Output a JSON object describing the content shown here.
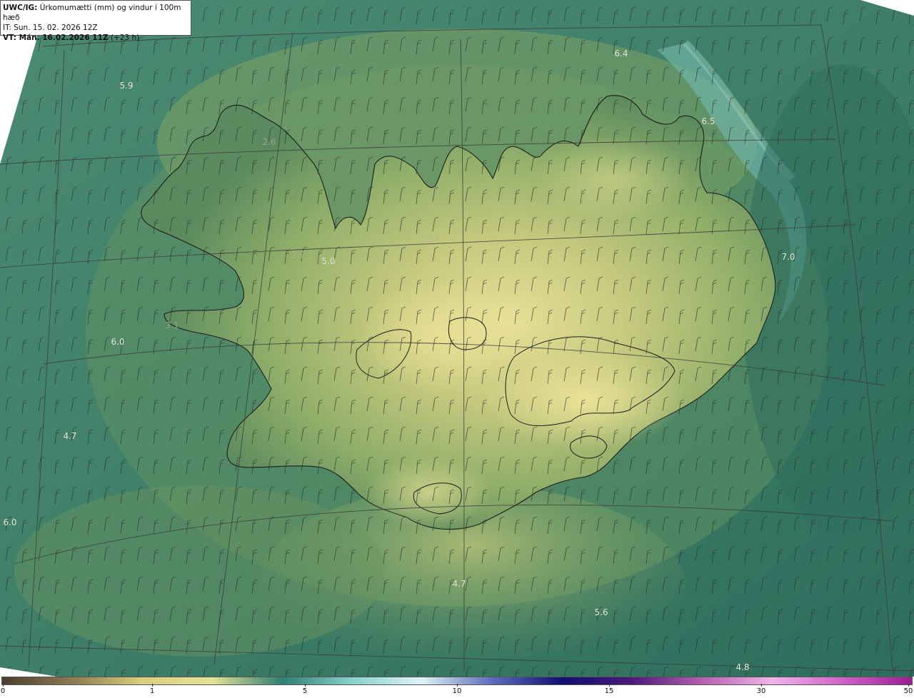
{
  "header": {
    "model_prefix": "UWC/IG:",
    "title": " Úrkomumætti (mm) og vindur í 100m hæð",
    "issued": "IT: Sun. 15. 02. 2026 12Z",
    "valid_prefix": "VT: Mán. 16.02.2026 11Z",
    "valid_suffix": " (+23 h)"
  },
  "map_labels": [
    {
      "text": "5.9"
    },
    {
      "text": "6.4"
    },
    {
      "text": "6.5"
    },
    {
      "text": "7.0"
    },
    {
      "text": "2.6"
    },
    {
      "text": "2.7"
    },
    {
      "text": "5.0"
    },
    {
      "text": "4.4"
    },
    {
      "text": "3.1"
    },
    {
      "text": "6.0"
    },
    {
      "text": "4.7"
    },
    {
      "text": "6.0"
    },
    {
      "text": "4.7"
    },
    {
      "text": "5.6"
    },
    {
      "text": "4.8"
    }
  ],
  "colorbar": {
    "ticks": [
      "0",
      "1",
      "5",
      "10",
      "15",
      "30",
      "50"
    ],
    "colors": [
      "#4b3d2e",
      "#8d7b52",
      "#d8cf7d",
      "#e4e296",
      "#2f7f72",
      "#87d2cc",
      "#dff3f4",
      "#5c6dbd",
      "#101070",
      "#4a1a7a",
      "#b65fb0",
      "#f0b4ea",
      "#d262c9",
      "#9a1e92"
    ]
  },
  "palette": {
    "sea": "#3a7a66",
    "land_low": "#6f9a5e",
    "land_mid": "#a9b86a",
    "land_high": "#e0dc8c",
    "cyan_band": "#6fb0a3",
    "outside": "#ffffff"
  }
}
